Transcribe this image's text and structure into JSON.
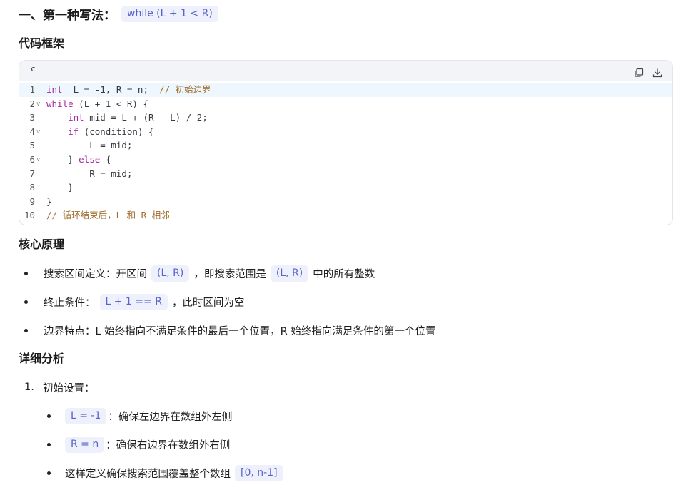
{
  "section1": {
    "heading": "一、第一种写法：",
    "heading_code": "while (L + 1 < R)"
  },
  "code_framework": {
    "title": "代码框架",
    "language": "c",
    "lines": [
      {
        "n": "1",
        "fold": "",
        "html_parts": [
          [
            "ty",
            "int"
          ],
          [
            "",
            "  L = -1, R = n;  "
          ],
          [
            "cm",
            "// 初始边界"
          ]
        ]
      },
      {
        "n": "2",
        "fold": "v",
        "html_parts": [
          [
            "kw",
            "while"
          ],
          [
            "",
            " (L + 1 < R) {"
          ]
        ]
      },
      {
        "n": "3",
        "fold": "",
        "html_parts": [
          [
            "",
            "    "
          ],
          [
            "ty",
            "int"
          ],
          [
            "",
            " mid = L + (R - L) / 2;"
          ]
        ]
      },
      {
        "n": "4",
        "fold": "v",
        "html_parts": [
          [
            "",
            "    "
          ],
          [
            "kw",
            "if"
          ],
          [
            "",
            " (condition) {"
          ]
        ]
      },
      {
        "n": "5",
        "fold": "",
        "html_parts": [
          [
            "",
            "        L = mid;"
          ]
        ]
      },
      {
        "n": "6",
        "fold": "v",
        "html_parts": [
          [
            "",
            "    } "
          ],
          [
            "kw",
            "else"
          ],
          [
            "",
            " {"
          ]
        ]
      },
      {
        "n": "7",
        "fold": "",
        "html_parts": [
          [
            "",
            "        R = mid;"
          ]
        ]
      },
      {
        "n": "8",
        "fold": "",
        "html_parts": [
          [
            "",
            "    }"
          ]
        ]
      },
      {
        "n": "9",
        "fold": "",
        "html_parts": [
          [
            "",
            "}"
          ]
        ]
      },
      {
        "n": "10",
        "fold": "",
        "html_parts": [
          [
            "cm",
            "// 循环结束后，L 和 R 相邻"
          ]
        ]
      }
    ]
  },
  "core_principle": {
    "title": "核心原理",
    "items": [
      {
        "pre": "搜索区间定义：开区间",
        "code1": "(L, R)",
        "mid": "，即搜索范围是",
        "code2": "(L, R)",
        "post": "中的所有整数"
      },
      {
        "pre": "终止条件：",
        "code1": "L + 1 == R",
        "post": "，此时区间为空"
      },
      {
        "pre": "边界特点：L 始终指向不满足条件的最后一个位置，R 始终指向满足条件的第一个位置"
      }
    ]
  },
  "detail": {
    "title": "详细分析",
    "step1_num": "1.",
    "step1_label": "初始设置：",
    "sub_items": [
      {
        "code": "L = -1",
        "text": "：确保左边界在数组外左侧"
      },
      {
        "code": "R = n",
        "text": "：确保右边界在数组外右侧"
      },
      {
        "pre": "这样定义确保搜索范围覆盖整个数组",
        "code": "[0, n-1]"
      }
    ]
  },
  "icons": {
    "copy": "copy-icon",
    "download": "download-icon"
  },
  "colors": {
    "inline_code_bg": "#eef0fb",
    "inline_code_fg": "#5a63c9",
    "keyword": "#a626a4",
    "comment": "#a06d2d",
    "active_line": "#eef7fd"
  }
}
